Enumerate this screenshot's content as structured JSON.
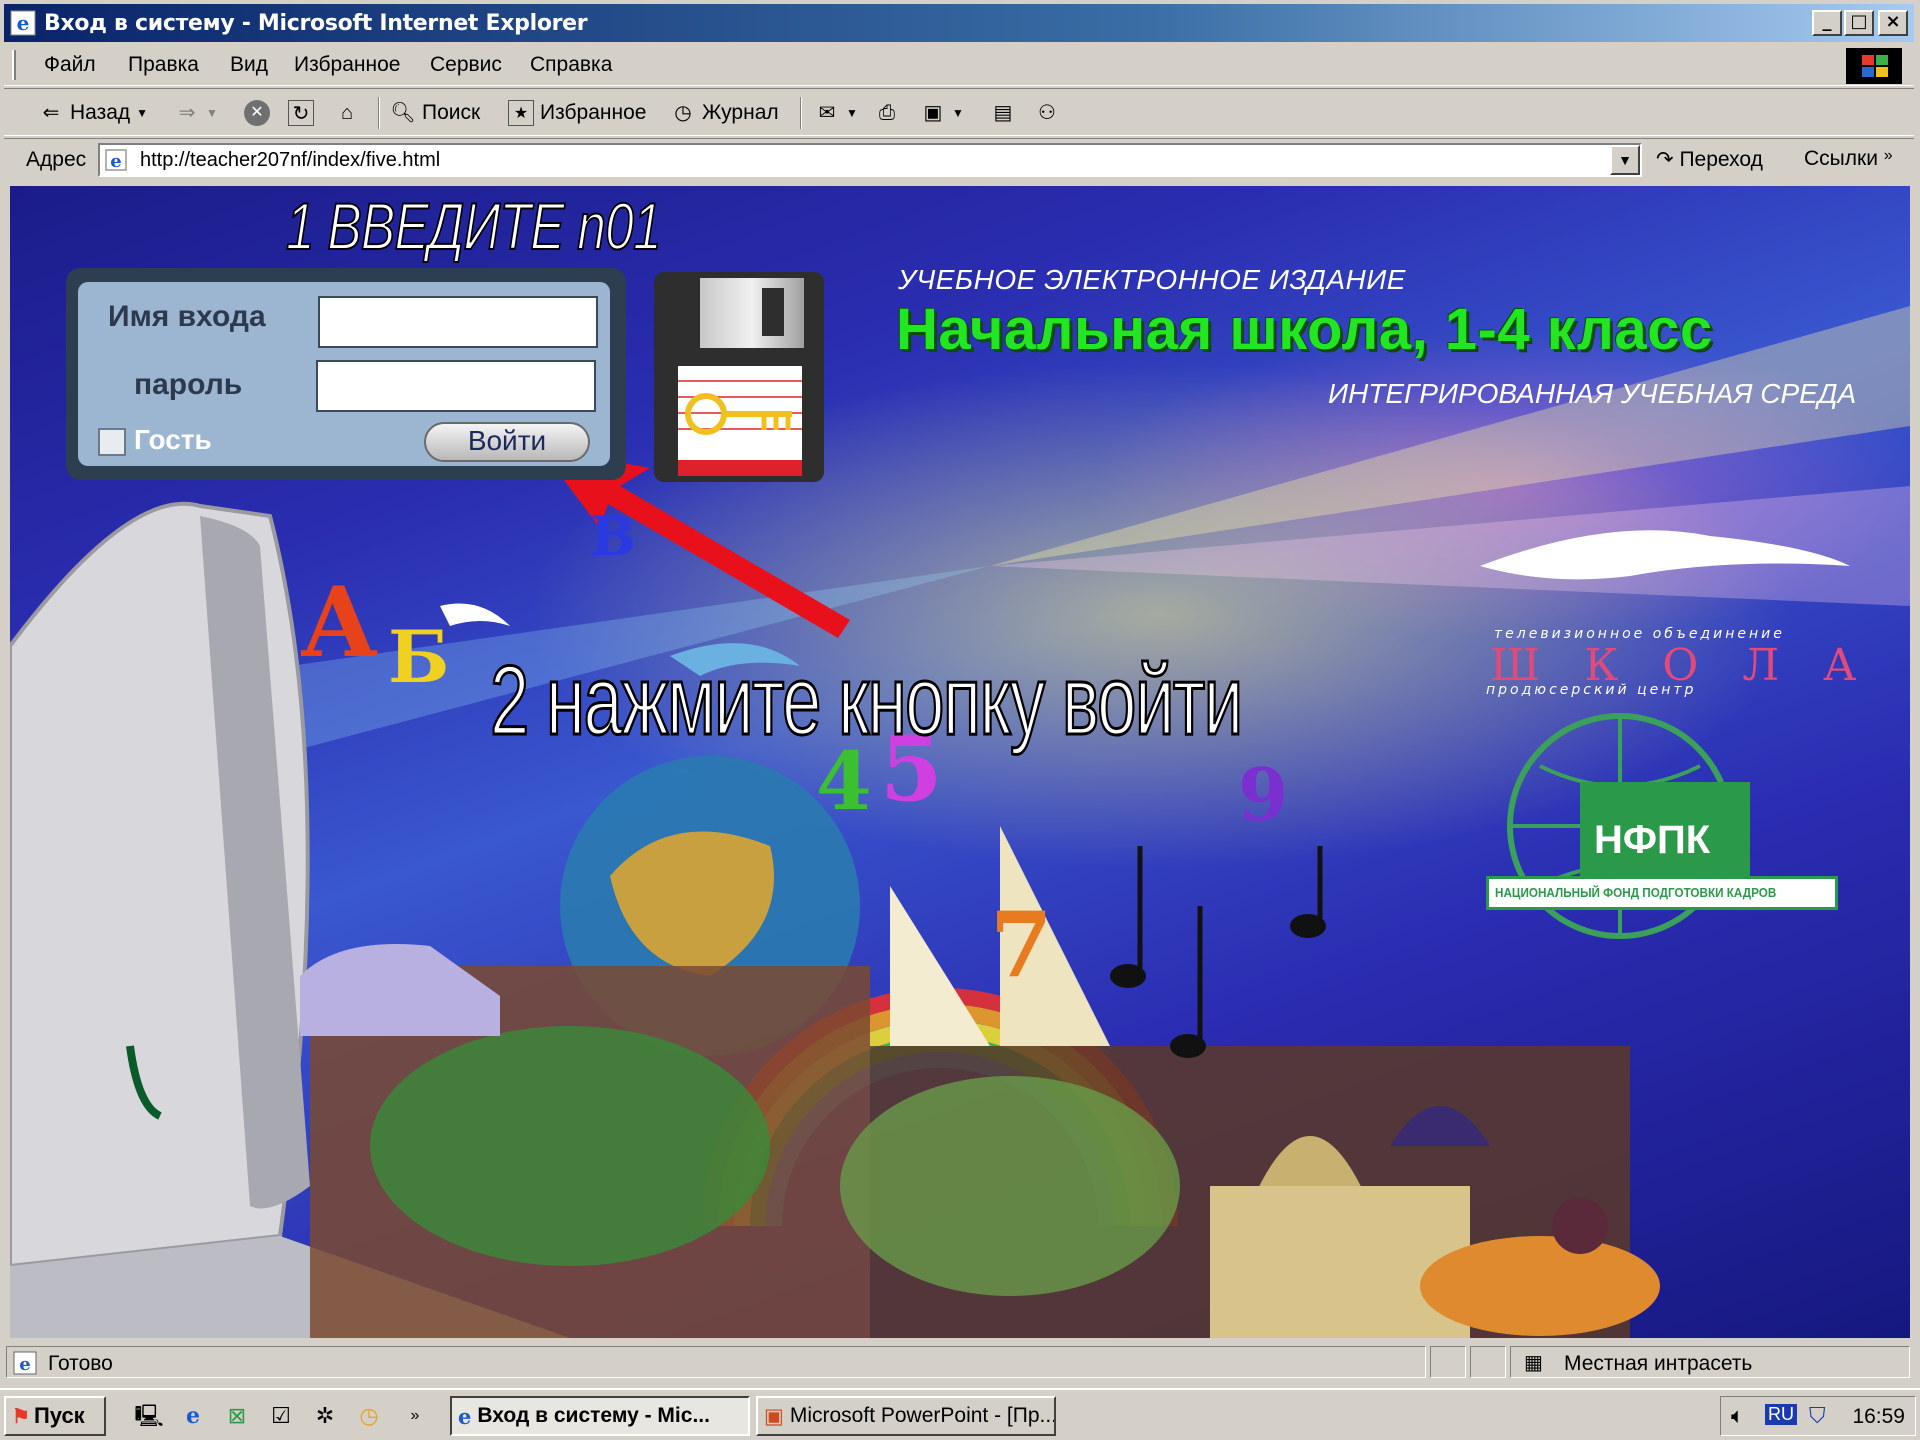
{
  "window": {
    "title": "Вход в систему - Microsoft Internet Explorer"
  },
  "menu": [
    "Файл",
    "Правка",
    "Вид",
    "Избранное",
    "Сервис",
    "Справка"
  ],
  "toolbar": {
    "back": "Назад",
    "search": "Поиск",
    "favorites": "Избранное",
    "history": "Журнал"
  },
  "address": {
    "label": "Адрес",
    "url": "http://teacher207nf/index/five.html",
    "go": "Переход",
    "links": "Ссылки"
  },
  "page": {
    "annotation_step1": "1 ВВЕДИТЕ n01",
    "annotation_step2": "2 нажмите кнопку войти",
    "login": {
      "username_label": "Имя входа",
      "password_label": "пароль",
      "guest_label": "Гость",
      "enter_button": "Войти",
      "username_value": "",
      "password_value": ""
    },
    "edition": "УЧЕБНОЕ ЭЛЕКТРОННОЕ ИЗДАНИЕ",
    "school_title": "Начальная школа, 1-4 класс",
    "integrated": "ИНТЕГРИРОВАННАЯ УЧЕБНАЯ СРЕДА",
    "tv_caption": "телевизионное объединение",
    "school_logo": "ШКОЛА",
    "producer": "продюсерский центр",
    "nfpk": "НФПК",
    "nfpk_full": "НАЦИОНАЛЬНЫЙ ФОНД ПОДГОТОВКИ КАДРОВ",
    "letters": [
      "А",
      "Б",
      "В",
      "4",
      "5",
      "7",
      "9"
    ]
  },
  "status": {
    "text": "Готово",
    "zone": "Местная интрасеть"
  },
  "taskbar": {
    "start": "Пуск",
    "tasks": [
      "Вход в систему - Mic...",
      "Microsoft PowerPoint - [Пр..."
    ],
    "lang": "RU",
    "clock": "16:59"
  },
  "colors": {
    "title_bar": "#0a246a",
    "school_title": "#22e622",
    "arrow": "#e8101a"
  }
}
